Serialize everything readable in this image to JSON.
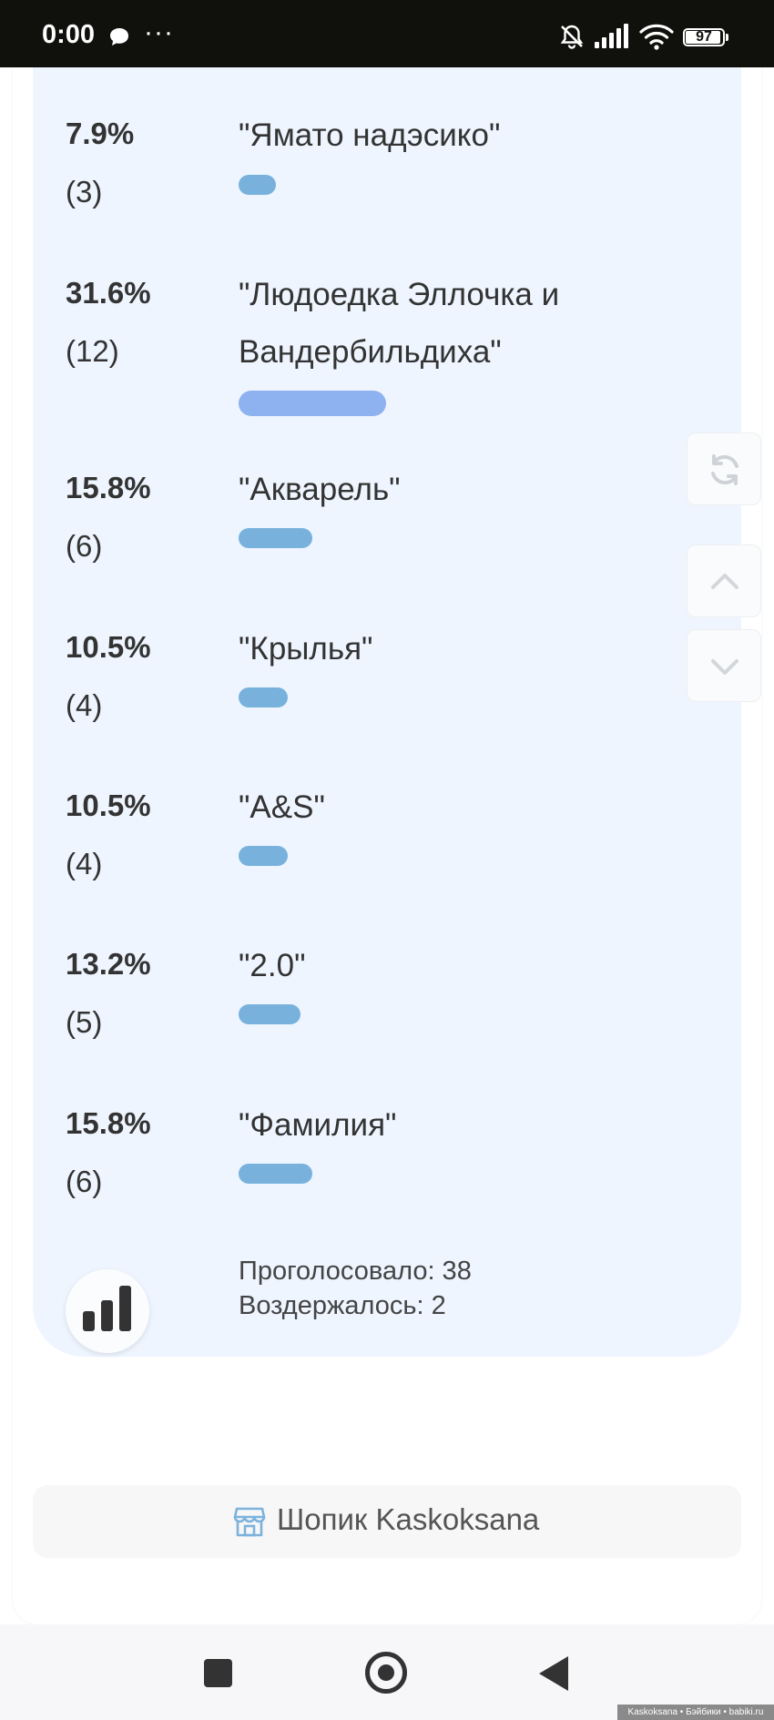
{
  "status_bar": {
    "time": "0:00",
    "more": "···",
    "battery": "97"
  },
  "poll": {
    "options": [
      {
        "percent": "7.9%",
        "count": "(3)",
        "label": "\"Ямато надэсико\"",
        "share": 0.079,
        "leader": false
      },
      {
        "percent": "31.6%",
        "count": "(12)",
        "label": "\"Людоедка Эллочка и Вандербильдиха\"",
        "share": 0.316,
        "leader": true
      },
      {
        "percent": "15.8%",
        "count": "(6)",
        "label": "\"Акварель\"",
        "share": 0.158,
        "leader": false
      },
      {
        "percent": "10.5%",
        "count": "(4)",
        "label": "\"Крылья\"",
        "share": 0.105,
        "leader": false
      },
      {
        "percent": "10.5%",
        "count": "(4)",
        "label": "\"A&S\"",
        "share": 0.105,
        "leader": false
      },
      {
        "percent": "13.2%",
        "count": "(5)",
        "label": "\"2.0\"",
        "share": 0.132,
        "leader": false
      },
      {
        "percent": "15.8%",
        "count": "(6)",
        "label": "\"Фамилия\"",
        "share": 0.158,
        "leader": false
      }
    ],
    "voted": "Проголосовало: 38",
    "abstained": "Воздержалось: 2"
  },
  "shop": {
    "label": "Шопик Kaskoksana"
  },
  "icons": {
    "chat": "chat-bubble-icon",
    "mute": "bell-off-icon",
    "signal": "signal-bars-icon",
    "wifi": "wifi-icon",
    "refresh": "refresh-icon",
    "scroll_up": "chevron-up-icon",
    "scroll_down": "chevron-down-icon",
    "stats": "bar-chart-icon",
    "shop": "storefront-icon"
  },
  "colors": {
    "card_bg": "#eef5ff",
    "bar": "#78b2dc",
    "bar_leader": "#8eb1ef",
    "status_bar_bg": "#10110d"
  },
  "watermark": "Kaskoksana • Бэйбики • babiki.ru"
}
